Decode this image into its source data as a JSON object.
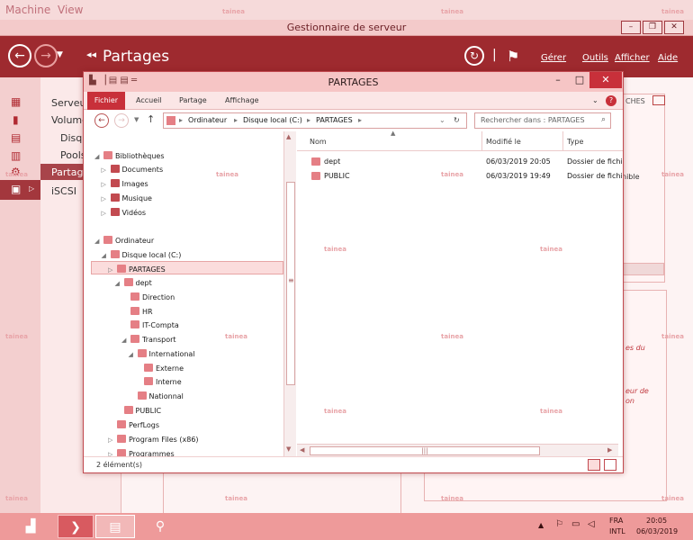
{
  "vm_menu": [
    "Machine",
    "View"
  ],
  "watermark": "tainea",
  "server_manager": {
    "title": "Gestionnaire de serveur",
    "breadcrumb": "Partages",
    "menus": [
      "Gérer",
      "Outils",
      "Afficher",
      "Aide"
    ],
    "nav_items": [
      "Serveur",
      "Volume",
      "Disqu",
      "Pools",
      "Partage",
      "iSCSI"
    ],
    "background_texts": [
      "CHES",
      "nible",
      "es du",
      "eur de",
      "on"
    ]
  },
  "explorer": {
    "title": "PARTAGES",
    "ribbon_tabs": [
      "Fichier",
      "Accueil",
      "Partage",
      "Affichage"
    ],
    "address_segments": [
      "Ordinateur",
      "Disque local (C:)",
      "PARTAGES"
    ],
    "search_placeholder": "Rechercher dans : PARTAGES",
    "tree": [
      {
        "label": "Bibliothèques",
        "depth": 0,
        "caret": "◢"
      },
      {
        "label": "Documents",
        "depth": 1,
        "caret": "▷"
      },
      {
        "label": "Images",
        "depth": 1,
        "caret": "▷"
      },
      {
        "label": "Musique",
        "depth": 1,
        "caret": "▷"
      },
      {
        "label": "Vidéos",
        "depth": 1,
        "caret": "▷"
      },
      {
        "label": "Ordinateur",
        "depth": 0,
        "caret": "◢"
      },
      {
        "label": "Disque local (C:)",
        "depth": 1,
        "caret": "◢"
      },
      {
        "label": "PARTAGES",
        "depth": 2,
        "caret": "▷"
      },
      {
        "label": "dept",
        "depth": 3,
        "caret": "◢"
      },
      {
        "label": "Direction",
        "depth": 4,
        "caret": ""
      },
      {
        "label": "HR",
        "depth": 4,
        "caret": ""
      },
      {
        "label": "IT-Compta",
        "depth": 4,
        "caret": ""
      },
      {
        "label": "Transport",
        "depth": 4,
        "caret": "◢"
      },
      {
        "label": "International",
        "depth": 5,
        "caret": "◢"
      },
      {
        "label": "Externe",
        "depth": 6,
        "caret": ""
      },
      {
        "label": "Interne",
        "depth": 6,
        "caret": ""
      },
      {
        "label": "Nationnal",
        "depth": 5,
        "caret": ""
      },
      {
        "label": "PUBLIC",
        "depth": 3,
        "caret": ""
      },
      {
        "label": "PerfLogs",
        "depth": 2,
        "caret": ""
      },
      {
        "label": "Program Files (x86)",
        "depth": 2,
        "caret": "▷"
      },
      {
        "label": "Programmes",
        "depth": 2,
        "caret": "▷"
      }
    ],
    "columns": [
      "Nom",
      "Modifié le",
      "Type"
    ],
    "files": [
      {
        "name": "dept",
        "modified": "06/03/2019 20:05",
        "type": "Dossier de fichiers"
      },
      {
        "name": "PUBLIC",
        "modified": "06/03/2019 19:49",
        "type": "Dossier de fichiers"
      }
    ],
    "status": "2 élément(s)"
  },
  "tray": {
    "lang": "FRA",
    "layout": "INTL",
    "time": "20:05",
    "date": "06/03/2019"
  }
}
